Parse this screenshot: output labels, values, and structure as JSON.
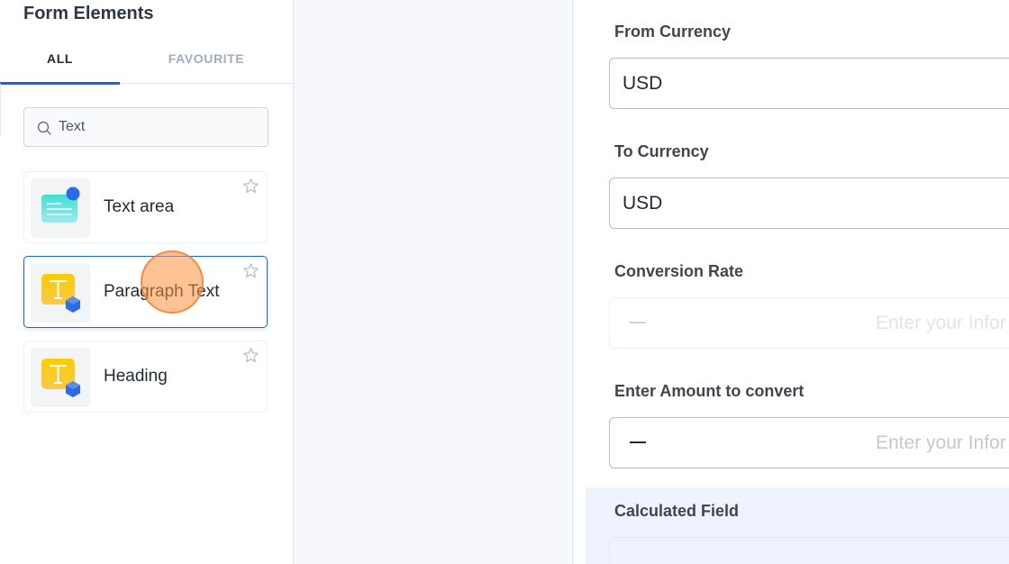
{
  "left_panel": {
    "title": "Form Elements",
    "tabs": [
      {
        "label": "ALL",
        "active": true
      },
      {
        "label": "FAVOURITE",
        "active": false
      }
    ],
    "search": {
      "value": "Text",
      "icon": "search-icon"
    },
    "elements": [
      {
        "label": "Text area",
        "icon": "text-area-icon",
        "favourite_icon": "star-outline-icon",
        "selected": false
      },
      {
        "label": "Paragraph Text",
        "icon": "paragraph-text-icon",
        "favourite_icon": "star-outline-icon",
        "selected": true
      },
      {
        "label": "Heading",
        "icon": "heading-icon",
        "favourite_icon": "star-outline-icon",
        "selected": false
      }
    ]
  },
  "form": {
    "fields": [
      {
        "label": "From Currency",
        "value": "USD"
      },
      {
        "label": "To Currency",
        "value": "USD"
      },
      {
        "label": "Conversion Rate",
        "value": "",
        "placeholder": "Enter your Infor",
        "disabled": true
      },
      {
        "label": "Enter Amount to convert",
        "value": "",
        "placeholder": "Enter your Infor",
        "disabled": false
      }
    ],
    "calculated": {
      "label": "Calculated Field"
    }
  },
  "colors": {
    "accent": "#1a64e0",
    "click_indicator": "#fb923c",
    "calc_background": "#eef3fd"
  }
}
